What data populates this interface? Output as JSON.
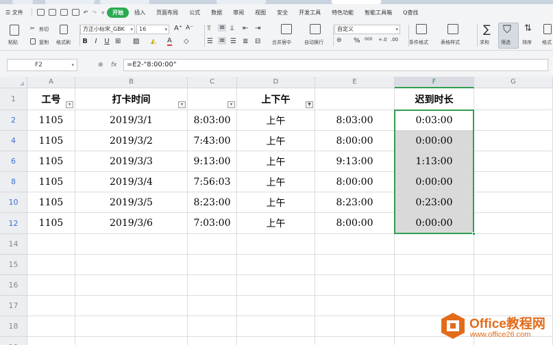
{
  "menu": {
    "file": "☰ 文件",
    "items": [
      {
        "label": "开始",
        "active": true
      },
      {
        "label": "插入"
      },
      {
        "label": "页面布局"
      },
      {
        "label": "公式"
      },
      {
        "label": "数据"
      },
      {
        "label": "审阅"
      },
      {
        "label": "视图"
      },
      {
        "label": "安全"
      },
      {
        "label": "开发工具"
      },
      {
        "label": "特色功能"
      },
      {
        "label": "智能工具箱"
      },
      {
        "label": "Q查找"
      }
    ]
  },
  "ribbon": {
    "paste": "粘贴",
    "cut": "剪切",
    "copy": "复制",
    "format_painter": "格式刷",
    "font_name": "方正小标宋_GBK",
    "font_size": "16",
    "bold": "B",
    "italic": "I",
    "underline": "U",
    "merge_center": "合并居中",
    "wrap_text": "自动换行",
    "number_format": "自定义",
    "percent": "%",
    "thousands": "000",
    "cond_format": "条件格式",
    "table_style": "表格样式",
    "sum": "求和",
    "filter": "筛选",
    "sort": "排序",
    "format": "格式"
  },
  "formula_bar": {
    "name_box": "F2",
    "fx": "fx",
    "formula": "=E2-\"8:00:00\""
  },
  "columns": [
    {
      "letter": "A"
    },
    {
      "letter": "B"
    },
    {
      "letter": "C"
    },
    {
      "letter": "D"
    },
    {
      "letter": "E"
    },
    {
      "letter": "F",
      "selected": true
    },
    {
      "letter": "G"
    }
  ],
  "header_row": {
    "row_num": "1",
    "cells": [
      "工号",
      "打卡时间",
      "",
      "上下午",
      "",
      "迟到时长"
    ]
  },
  "data_rows": [
    {
      "row_num": "2",
      "cells": [
        "1105",
        "2019/3/1",
        "8:03:00",
        "上午",
        "8:03:00",
        "0:03:00"
      ]
    },
    {
      "row_num": "4",
      "cells": [
        "1105",
        "2019/3/2",
        "7:43:00",
        "上午",
        "8:00:00",
        "0:00:00"
      ]
    },
    {
      "row_num": "6",
      "cells": [
        "1105",
        "2019/3/3",
        "9:13:00",
        "上午",
        "9:13:00",
        "1:13:00"
      ]
    },
    {
      "row_num": "8",
      "cells": [
        "1105",
        "2019/3/4",
        "7:56:03",
        "上午",
        "8:00:00",
        "0:00:00"
      ]
    },
    {
      "row_num": "10",
      "cells": [
        "1105",
        "2019/3/5",
        "8:23:00",
        "上午",
        "8:23:00",
        "0:23:00"
      ]
    },
    {
      "row_num": "12",
      "cells": [
        "1105",
        "2019/3/6",
        "7:03:00",
        "上午",
        "8:00:00",
        "0:00:00"
      ]
    }
  ],
  "empty_rows": [
    "14",
    "15",
    "16",
    "17",
    "18",
    "19"
  ],
  "watermark": {
    "title": "Office教程网",
    "url": "www.office26.com"
  },
  "colors": {
    "accent_green": "#2e9e4e",
    "selection_grey": "#d9d9d9",
    "filtered_row_blue": "#3b6fd1",
    "watermark_orange": "#e36b1a"
  }
}
